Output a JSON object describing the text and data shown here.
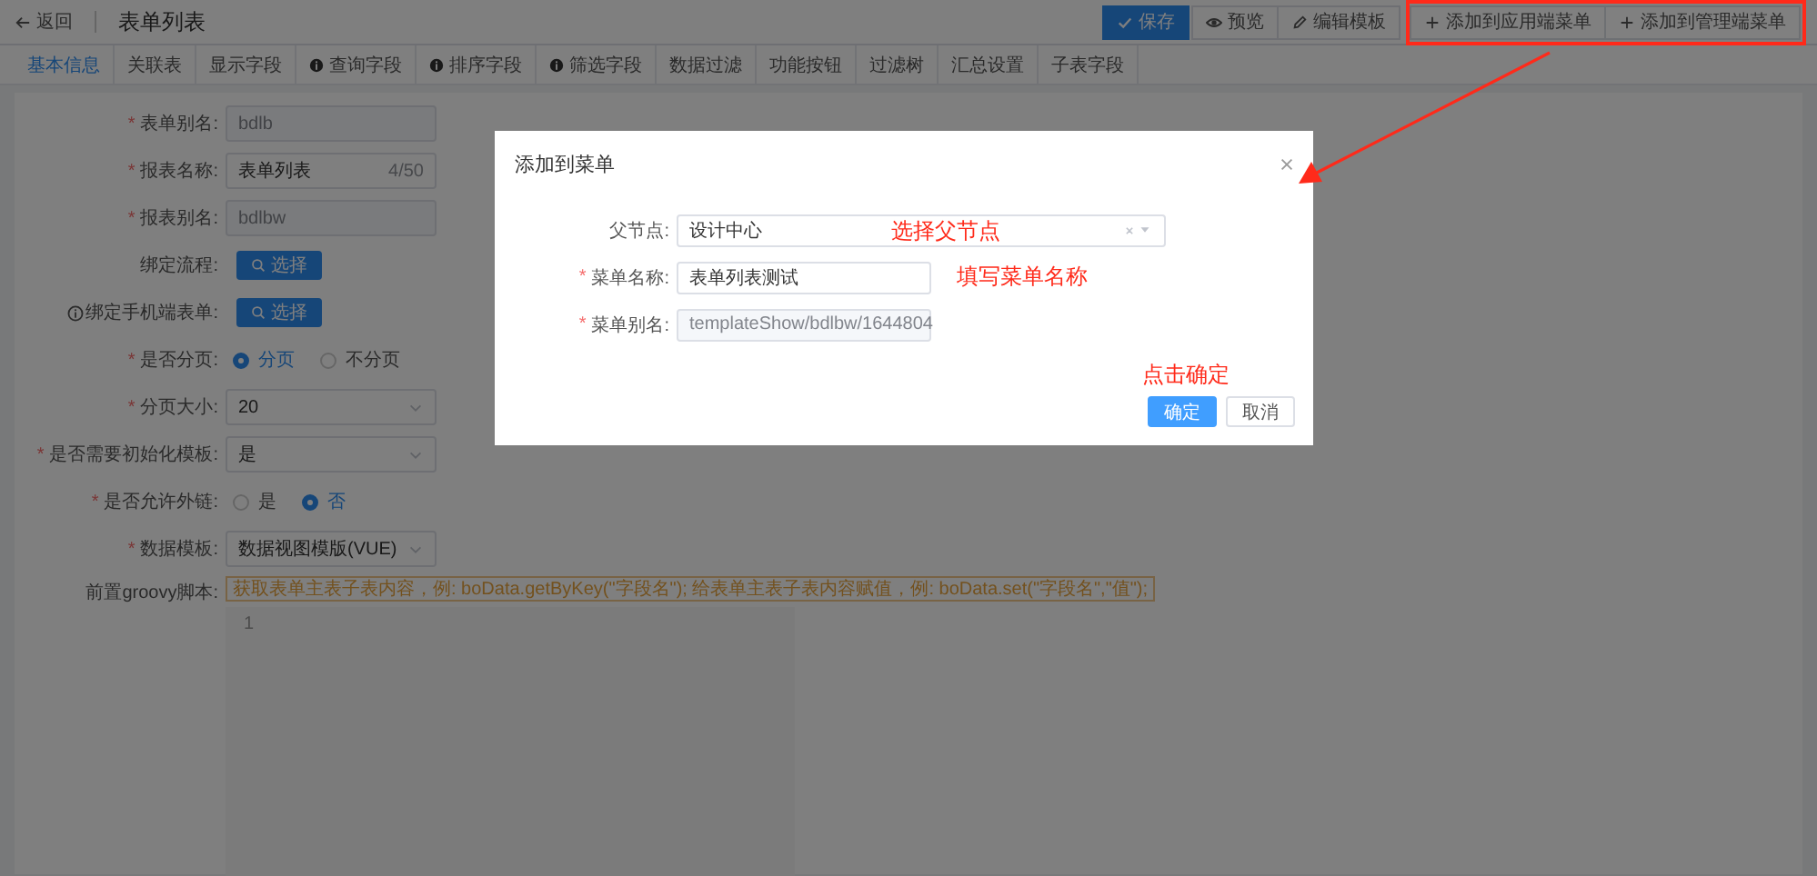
{
  "header": {
    "back_label": "返回",
    "title": "表单列表"
  },
  "toolbar": [
    {
      "label": "保存",
      "kind": "save",
      "highlighted": false
    },
    {
      "label": "预览",
      "kind": "preview",
      "highlighted": false
    },
    {
      "label": "编辑模板",
      "kind": "edit",
      "highlighted": false
    },
    {
      "label": "添加到应用端菜单",
      "kind": "add",
      "highlighted": true
    },
    {
      "label": "添加到管理端菜单",
      "kind": "add",
      "highlighted": true
    }
  ],
  "tabs": [
    {
      "label": "基本信息",
      "selected": true,
      "info": false
    },
    {
      "label": "关联表",
      "selected": false,
      "info": false
    },
    {
      "label": "显示字段",
      "selected": false,
      "info": false
    },
    {
      "label": "查询字段",
      "selected": false,
      "info": true
    },
    {
      "label": "排序字段",
      "selected": false,
      "info": true
    },
    {
      "label": "筛选字段",
      "selected": false,
      "info": true
    },
    {
      "label": "数据过滤",
      "selected": false,
      "info": false
    },
    {
      "label": "功能按钮",
      "selected": false,
      "info": false
    },
    {
      "label": "过滤树",
      "selected": false,
      "info": false
    },
    {
      "label": "汇总设置",
      "selected": false,
      "info": false
    },
    {
      "label": "子表字段",
      "selected": false,
      "info": false
    }
  ],
  "form": [
    {
      "required_mark": "*",
      "label": "表单别名:",
      "kind": "input",
      "value": "bdlb",
      "disabled": true
    },
    {
      "required_mark": "*",
      "label": "报表名称:",
      "kind": "input",
      "value": "表单列表",
      "counter": "4/50",
      "disabled": false
    },
    {
      "required_mark": "*",
      "label": "报表别名:",
      "kind": "input",
      "value": "bdlbw",
      "disabled": true
    },
    {
      "label": "绑定流程:",
      "kind": "button",
      "button": "选择"
    },
    {
      "label": "绑定手机端表单:",
      "info": true,
      "kind": "button",
      "button": "选择"
    },
    {
      "required_mark": "*",
      "label": "是否分页:",
      "kind": "radio",
      "options": [
        {
          "label": "分页",
          "selected": true
        },
        {
          "label": "不分页",
          "selected": false
        }
      ]
    },
    {
      "required_mark": "*",
      "label": "分页大小:",
      "kind": "select",
      "value": "20"
    },
    {
      "required_mark": "*",
      "label": "是否需要初始化模板:",
      "kind": "select",
      "value": "是"
    },
    {
      "required_mark": "*",
      "label": "是否允许外链:",
      "kind": "radio",
      "options": [
        {
          "label": "是",
          "selected": false
        },
        {
          "label": "否",
          "selected": true
        }
      ]
    },
    {
      "required_mark": "*",
      "label": "数据模板:",
      "kind": "select",
      "value": "数据视图模版(VUE)"
    },
    {
      "label": "前置groovy脚本:",
      "kind": "script",
      "hint": "获取表单主表子表内容，例: boData.getByKey(\"字段名\"); 给表单主表子表内容赋值，例: boData.set(\"字段名\",\"值\");",
      "line_numbers": [
        "1"
      ]
    }
  ],
  "dialog": {
    "title": "添加到菜单",
    "fields": [
      {
        "label": "父节点:",
        "kind": "select",
        "value": "设计中心",
        "clearable": true,
        "annotation": "选择父节点"
      },
      {
        "required_mark": "*",
        "label": "菜单名称:",
        "kind": "input",
        "value": "表单列表测试",
        "disabled": false,
        "annotation": "填写菜单名称"
      },
      {
        "required_mark": "*",
        "label": "菜单别名:",
        "kind": "input",
        "value": "templateShow/bdlbw/1644804",
        "disabled": true
      }
    ],
    "annotation": "点击确定",
    "buttons": [
      {
        "label": "确定",
        "kind": "primary"
      },
      {
        "label": "取消",
        "kind": "default"
      }
    ]
  }
}
